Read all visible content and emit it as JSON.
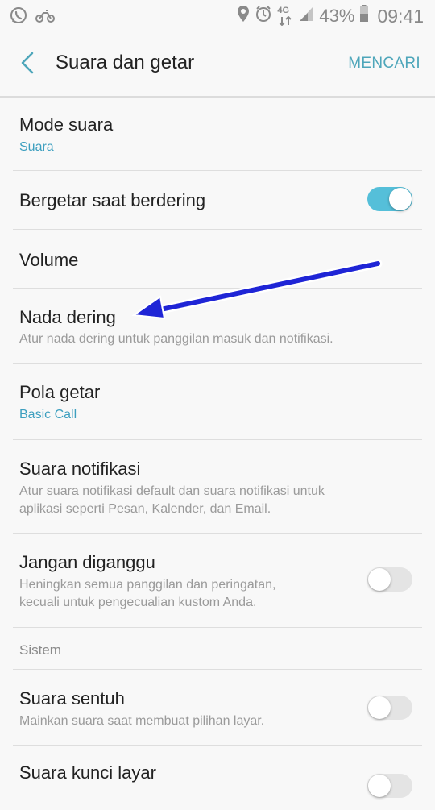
{
  "status_bar": {
    "battery": "43%",
    "network": "4G",
    "time": "09:41"
  },
  "header": {
    "title": "Suara dan getar",
    "search_label": "MENCARI"
  },
  "settings": {
    "mode_suara": {
      "title": "Mode suara",
      "value": "Suara"
    },
    "bergetar": {
      "title": "Bergetar saat berdering",
      "enabled": true
    },
    "volume": {
      "title": "Volume"
    },
    "nada_dering": {
      "title": "Nada dering",
      "description": "Atur nada dering untuk panggilan masuk dan notifikasi."
    },
    "pola_getar": {
      "title": "Pola getar",
      "value": "Basic Call"
    },
    "suara_notifikasi": {
      "title": "Suara notifikasi",
      "description_line1": "Atur suara notifikasi default dan suara notifikasi untuk",
      "description_line2": "aplikasi seperti Pesan, Kalender, dan Email."
    },
    "jangan_diganggu": {
      "title": "Jangan diganggu",
      "description_line1": "Heningkan semua panggilan dan peringatan,",
      "description_line2": "kecuali untuk pengecualian kustom Anda.",
      "enabled": false
    }
  },
  "section_sistem": {
    "label": "Sistem",
    "suara_sentuh": {
      "title": "Suara sentuh",
      "description": "Mainkan suara saat membuat pilihan layar.",
      "enabled": false
    },
    "suara_kunci_layar": {
      "title": "Suara kunci layar"
    }
  },
  "colors": {
    "accent": "#4ea6ba",
    "toggle_on": "#55bfd9",
    "annotation_arrow": "#1f25d6"
  }
}
